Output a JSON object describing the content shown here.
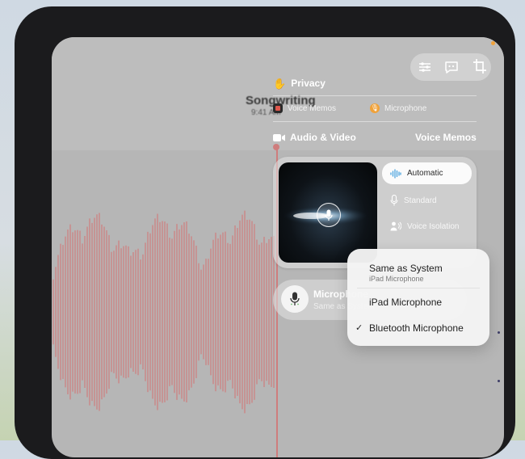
{
  "recording": {
    "title": "Songwriting",
    "time": "9:41 AM"
  },
  "privacy": {
    "label": "Privacy",
    "apps": [
      {
        "name": "Voice Memos",
        "icon": "voice-memos-app-icon"
      },
      {
        "name": "Microphone",
        "icon": "microphone-indicator-icon"
      }
    ]
  },
  "audio_video": {
    "label": "Audio & Video",
    "app": "Voice Memos"
  },
  "mic_modes": [
    {
      "label": "Automatic",
      "icon": "waveform-icon",
      "selected": true
    },
    {
      "label": "Standard",
      "icon": "microphone-icon",
      "selected": false
    },
    {
      "label": "Voice Isolation",
      "icon": "person-wave-icon",
      "selected": false
    }
  ],
  "microphone": {
    "title": "Microphone",
    "subtitle": "Same as System"
  },
  "mic_menu": [
    {
      "label": "Same as System",
      "sub": "iPad Microphone",
      "checked": false
    },
    {
      "label": "iPad Microphone",
      "sub": "",
      "checked": false
    },
    {
      "label": "Bluetooth Microphone",
      "sub": "",
      "checked": true
    }
  ],
  "toolbar": {
    "icons": [
      "sliders-icon",
      "transcript-icon",
      "crop-icon"
    ]
  },
  "colors": {
    "accent": "#f0a23a",
    "waveform": "#cf7d7d",
    "menu_bg": "#f5f5f5"
  }
}
